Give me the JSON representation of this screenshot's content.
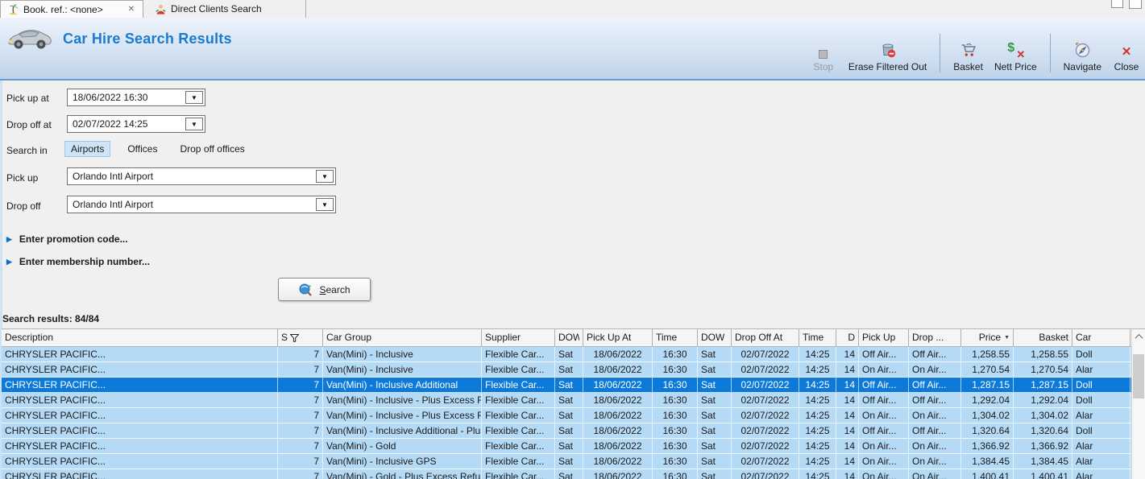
{
  "tabs": [
    {
      "label": "Book. ref.: <none>",
      "active": true,
      "close_glyph": "✕"
    },
    {
      "label": "Direct Clients Search",
      "active": false
    }
  ],
  "header": {
    "title": "Car Hire Search Results"
  },
  "toolbar": {
    "buttons": [
      {
        "label": "Stop",
        "disabled": true
      },
      {
        "label": "Erase Filtered Out"
      },
      {
        "label": "Basket"
      },
      {
        "label": "Nett Price"
      },
      {
        "label": "Navigate"
      },
      {
        "label": "Close"
      }
    ]
  },
  "icons": {
    "combo_arrow": "▼",
    "expander": "▶",
    "close_x": "✕",
    "nett_dollar": "$",
    "nett_x": "✕"
  },
  "form": {
    "pickup_at": {
      "label": "Pick up at",
      "value": "18/06/2022 16:30"
    },
    "dropoff_at": {
      "label": "Drop off at",
      "value": "02/07/2022 14:25"
    },
    "search_in": {
      "label": "Search in",
      "options": [
        {
          "label": "Airports",
          "selected": true
        },
        {
          "label": "Offices",
          "selected": false
        },
        {
          "label": "Drop off offices",
          "selected": false
        }
      ]
    },
    "pickup": {
      "label": "Pick up",
      "value": "Orlando Intl Airport"
    },
    "dropoff": {
      "label": "Drop off",
      "value": "Orlando Intl Airport"
    },
    "promotion": {
      "label": "Enter promotion code..."
    },
    "membership": {
      "label": "Enter membership number..."
    },
    "search_button": {
      "label": "Search"
    }
  },
  "results": {
    "summary": "Search results: 84/84",
    "columns": [
      {
        "label": "Description"
      },
      {
        "label": "S",
        "filter_icon": true
      },
      {
        "label": "Car Group"
      },
      {
        "label": "Supplier"
      },
      {
        "label": "DOW"
      },
      {
        "label": "Pick Up At"
      },
      {
        "label": "Time"
      },
      {
        "label": "DOW"
      },
      {
        "label": "Drop Off At"
      },
      {
        "label": "Time"
      },
      {
        "label": "D"
      },
      {
        "label": "Pick Up"
      },
      {
        "label": "Drop ..."
      },
      {
        "label": "Price",
        "sort_indicator": "▼"
      },
      {
        "label": "Basket"
      },
      {
        "label": "Car"
      }
    ],
    "rows": [
      {
        "selected": false,
        "cells": [
          "CHRYSLER PACIFIC...",
          "7",
          "Van(Mini) - Inclusive",
          "Flexible Car...",
          "Sat",
          "18/06/2022",
          "16:30",
          "Sat",
          "02/07/2022",
          "14:25",
          "14",
          "Off Air...",
          "Off Air...",
          "1,258.55",
          "1,258.55",
          "Doll"
        ]
      },
      {
        "selected": false,
        "cells": [
          "CHRYSLER PACIFIC...",
          "7",
          "Van(Mini) - Inclusive",
          "Flexible Car...",
          "Sat",
          "18/06/2022",
          "16:30",
          "Sat",
          "02/07/2022",
          "14:25",
          "14",
          "On Air...",
          "On Air...",
          "1,270.54",
          "1,270.54",
          "Alar"
        ]
      },
      {
        "selected": true,
        "cells": [
          "CHRYSLER PACIFIC...",
          "7",
          "Van(Mini) - Inclusive Additional",
          "Flexible Car...",
          "Sat",
          "18/06/2022",
          "16:30",
          "Sat",
          "02/07/2022",
          "14:25",
          "14",
          "Off Air...",
          "Off Air...",
          "1,287.15",
          "1,287.15",
          "Doll"
        ]
      },
      {
        "selected": false,
        "cells": [
          "CHRYSLER PACIFIC...",
          "7",
          "Van(Mini) - Inclusive - Plus Excess Refund",
          "Flexible Car...",
          "Sat",
          "18/06/2022",
          "16:30",
          "Sat",
          "02/07/2022",
          "14:25",
          "14",
          "Off Air...",
          "Off Air...",
          "1,292.04",
          "1,292.04",
          "Doll"
        ]
      },
      {
        "selected": false,
        "cells": [
          "CHRYSLER PACIFIC...",
          "7",
          "Van(Mini) - Inclusive - Plus Excess Refund",
          "Flexible Car...",
          "Sat",
          "18/06/2022",
          "16:30",
          "Sat",
          "02/07/2022",
          "14:25",
          "14",
          "On Air...",
          "On Air...",
          "1,304.02",
          "1,304.02",
          "Alar"
        ]
      },
      {
        "selected": false,
        "cells": [
          "CHRYSLER PACIFIC...",
          "7",
          "Van(Mini) - Inclusive Additional - Plus Excess Refund",
          "Flexible Car...",
          "Sat",
          "18/06/2022",
          "16:30",
          "Sat",
          "02/07/2022",
          "14:25",
          "14",
          "Off Air...",
          "Off Air...",
          "1,320.64",
          "1,320.64",
          "Doll"
        ]
      },
      {
        "selected": false,
        "cells": [
          "CHRYSLER PACIFIC...",
          "7",
          "Van(Mini) - Gold",
          "Flexible Car...",
          "Sat",
          "18/06/2022",
          "16:30",
          "Sat",
          "02/07/2022",
          "14:25",
          "14",
          "On Air...",
          "On Air...",
          "1,366.92",
          "1,366.92",
          "Alar"
        ]
      },
      {
        "selected": false,
        "cells": [
          "CHRYSLER PACIFIC...",
          "7",
          "Van(Mini) - Inclusive GPS",
          "Flexible Car...",
          "Sat",
          "18/06/2022",
          "16:30",
          "Sat",
          "02/07/2022",
          "14:25",
          "14",
          "On Air...",
          "On Air...",
          "1,384.45",
          "1,384.45",
          "Alar"
        ]
      },
      {
        "selected": false,
        "cells": [
          "CHRYSLER PACIFIC...",
          "7",
          "Van(Mini) - Gold - Plus Excess Refund",
          "Flexible Car...",
          "Sat",
          "18/06/2022",
          "16:30",
          "Sat",
          "02/07/2022",
          "14:25",
          "14",
          "On Air...",
          "On Air...",
          "1,400.41",
          "1,400.41",
          "Alar"
        ]
      }
    ]
  }
}
